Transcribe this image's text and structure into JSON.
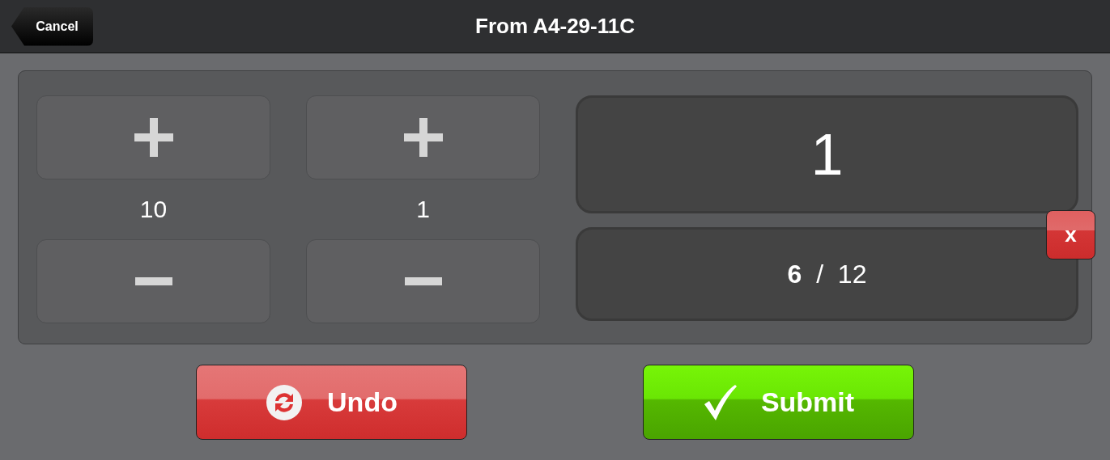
{
  "header": {
    "back_button": "Cancel",
    "title": "From A4-29-11C"
  },
  "steppers": [
    {
      "step": "10"
    },
    {
      "step": "1"
    }
  ],
  "display": {
    "value": "1"
  },
  "counter": "**6**  /  12",
  "clear_button": "x",
  "actions": [
    {
      "kind": "undo",
      "label": "Undo"
    },
    {
      "kind": "submit",
      "label": "Submit"
    }
  ]
}
